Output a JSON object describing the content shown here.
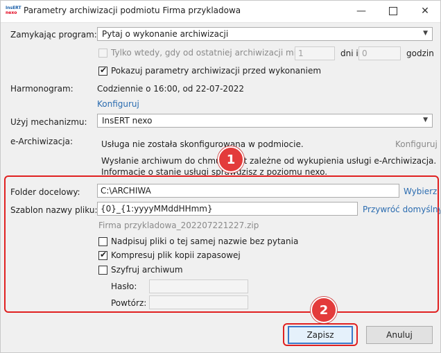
{
  "window": {
    "title": "Parametry archiwizacji podmiotu Firma przykladowa",
    "logo_line1": "InsERT",
    "logo_line2": "nexo"
  },
  "closing": {
    "label": "Zamykając program:",
    "value": "Pytaj o wykonanie archiwizacji",
    "only_when_label": "Tylko wtedy, gdy od ostatniej archiwizacji minęło:",
    "days_value": "1",
    "days_label": "dni i",
    "hours_value": "0",
    "hours_label": "godzin",
    "show_params_label": "Pokazuj parametry archiwizacji przed wykonaniem"
  },
  "schedule": {
    "label": "Harmonogram:",
    "value": "Codziennie o 16:00, od 22-07-2022",
    "configure_link": "Konfiguruj"
  },
  "mechanism": {
    "label": "Użyj mechanizmu:",
    "value": "InsERT nexo"
  },
  "earchive": {
    "label": "e-Archiwizacja:",
    "status": "Usługa nie została skonfigurowana w podmiocie.",
    "configure_link": "Konfiguruj",
    "info_line1": "Wysłanie archiwum do chmury jest zależne od wykupienia usługi e-Archiwizacja.",
    "info_line2": "Informacje o stanie usługi sprawdzisz z poziomu nexo."
  },
  "target": {
    "folder_label": "Folder docelowy:",
    "folder_value": "C:\\ARCHIWA",
    "browse_link": "Wybierz",
    "template_label": "Szablon nazwy pliku:",
    "template_value": "{0}_{1:yyyyMMddHHmm}",
    "restore_link": "Przywróć domyślny",
    "preview": "Firma przykladowa_202207221227.zip",
    "overwrite_label": "Nadpisuj pliki o tej samej nazwie bez pytania",
    "compress_label": "Kompresuj plik kopii zapasowej",
    "encrypt_label": "Szyfruj archiwum",
    "password_label": "Hasło:",
    "repeat_label": "Powtórz:"
  },
  "badges": {
    "one": "1",
    "two": "2"
  },
  "buttons": {
    "save": "Zapisz",
    "cancel": "Anuluj"
  },
  "icons": {
    "minimize": "minimize-icon",
    "maximize": "maximize-icon",
    "close": "close-icon",
    "dropdown": "chevron-down-icon",
    "check": "check-icon"
  },
  "colors": {
    "highlight": "#e02020",
    "link": "#2b6cb0",
    "badge": "#e33b3b"
  }
}
